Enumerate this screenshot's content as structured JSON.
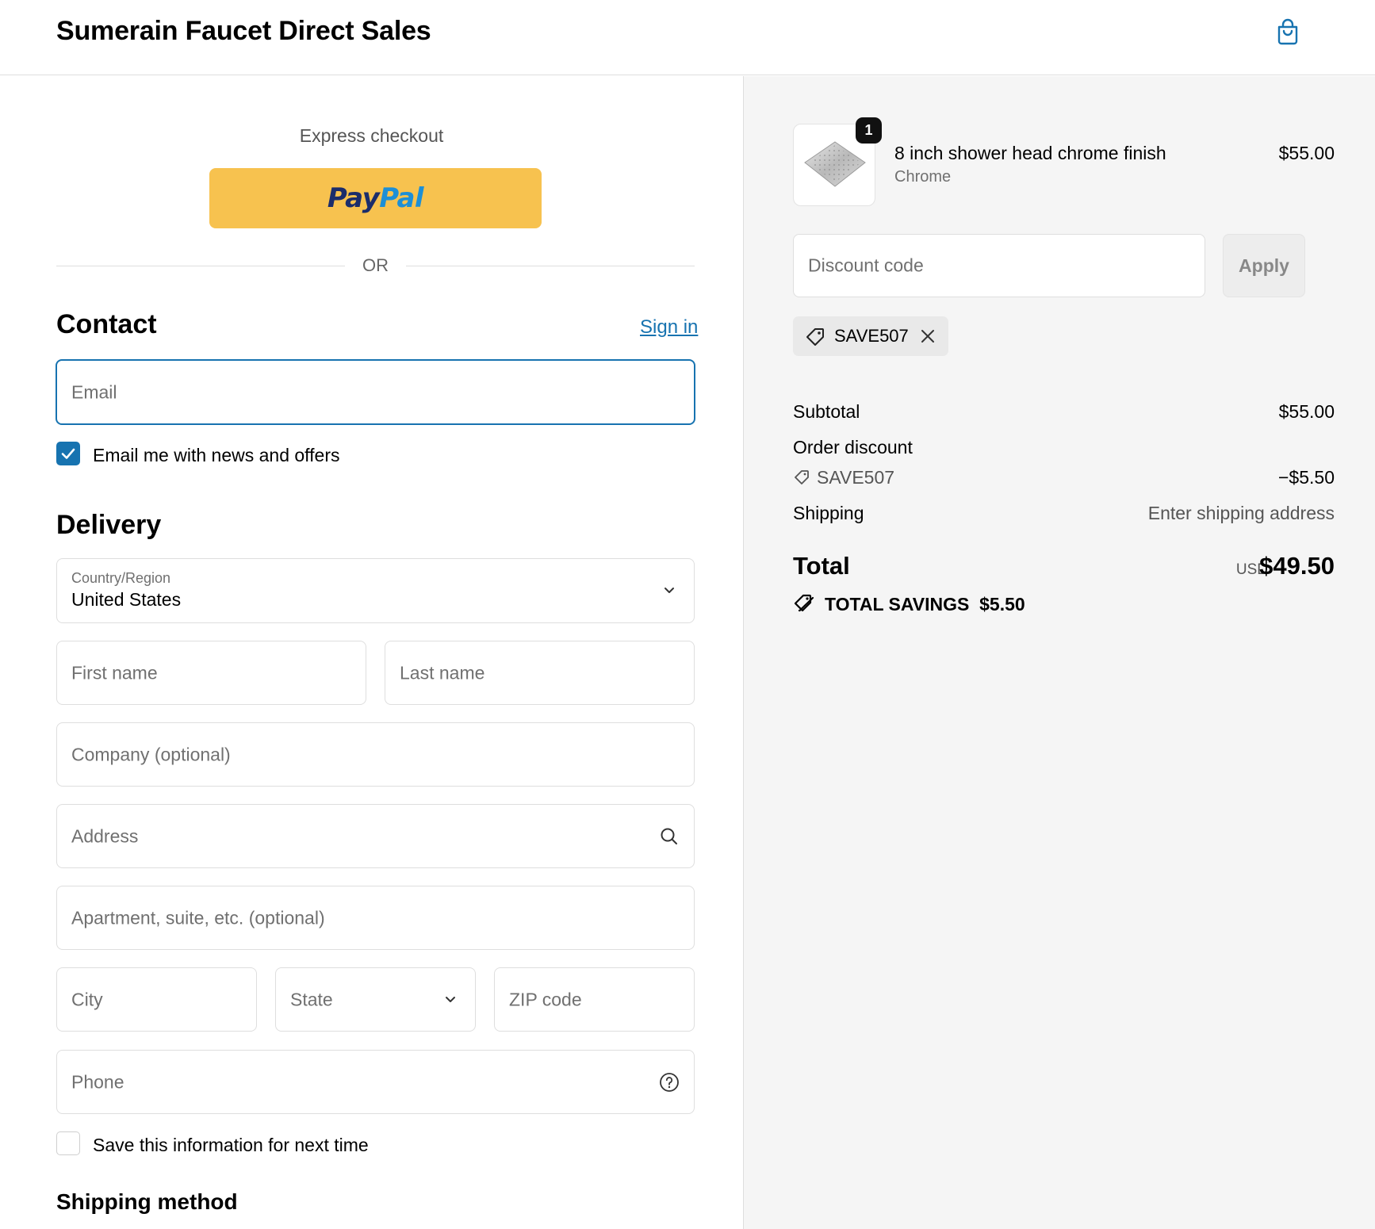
{
  "header": {
    "store_name": "Sumerain Faucet Direct Sales",
    "cart_icon": "shopping-bag-icon"
  },
  "express": {
    "label": "Express checkout",
    "paypal_pay": "Pay",
    "paypal_pal": "Pal",
    "or_text": "OR"
  },
  "contact": {
    "heading": "Contact",
    "signin_label": "Sign in",
    "email_placeholder": "Email",
    "newsletter_label": "Email me with news and offers",
    "newsletter_checked": true
  },
  "delivery": {
    "heading": "Delivery",
    "country_label": "Country/Region",
    "country_value": "United States",
    "first_name_placeholder": "First name",
    "last_name_placeholder": "Last name",
    "company_placeholder": "Company (optional)",
    "address_placeholder": "Address",
    "apartment_placeholder": "Apartment, suite, etc. (optional)",
    "city_placeholder": "City",
    "state_placeholder": "State",
    "zip_placeholder": "ZIP code",
    "phone_placeholder": "Phone",
    "save_info_label": "Save this information for next time",
    "save_info_checked": false
  },
  "shipping_method": {
    "heading": "Shipping method"
  },
  "order": {
    "item": {
      "name": "8 inch shower head chrome finish",
      "variant": "Chrome",
      "price": "$55.00",
      "quantity": "1"
    },
    "discount_placeholder": "Discount code",
    "apply_label": "Apply",
    "applied_code": "SAVE507",
    "subtotal_label": "Subtotal",
    "subtotal_value": "$55.00",
    "order_discount_label": "Order discount",
    "order_discount_code": "SAVE507",
    "order_discount_value": "−$5.50",
    "shipping_label": "Shipping",
    "shipping_value": "Enter shipping address",
    "total_label": "Total",
    "total_currency": "USD",
    "total_value": "$49.50",
    "savings_label": "TOTAL SAVINGS",
    "savings_value": "$5.50"
  },
  "colors": {
    "accent": "#1773b0",
    "paypal_yellow": "#f7c24f",
    "panel_bg": "#f5f5f5"
  }
}
